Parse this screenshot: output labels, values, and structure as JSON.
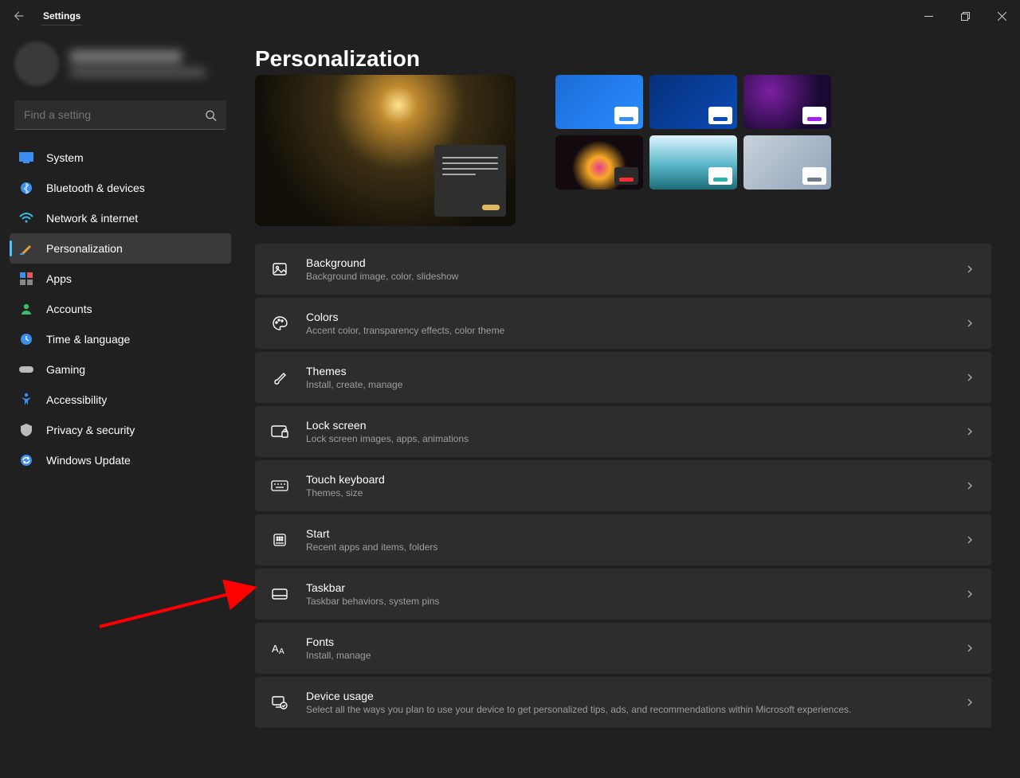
{
  "app_title": "Settings",
  "search": {
    "placeholder": "Find a setting"
  },
  "nav": [
    {
      "label": "System"
    },
    {
      "label": "Bluetooth & devices"
    },
    {
      "label": "Network & internet"
    },
    {
      "label": "Personalization"
    },
    {
      "label": "Apps"
    },
    {
      "label": "Accounts"
    },
    {
      "label": "Time & language"
    },
    {
      "label": "Gaming"
    },
    {
      "label": "Accessibility"
    },
    {
      "label": "Privacy & security"
    },
    {
      "label": "Windows Update"
    }
  ],
  "page_title": "Personalization",
  "theme_swatches": [
    "#3b90ef",
    "#0b4bb5",
    "#a020f0",
    "#ff2d2d",
    "#2bb3a7",
    "#6e7c8a"
  ],
  "rows": [
    {
      "title": "Background",
      "sub": "Background image, color, slideshow",
      "icon": "image"
    },
    {
      "title": "Colors",
      "sub": "Accent color, transparency effects, color theme",
      "icon": "palette"
    },
    {
      "title": "Themes",
      "sub": "Install, create, manage",
      "icon": "brush"
    },
    {
      "title": "Lock screen",
      "sub": "Lock screen images, apps, animations",
      "icon": "lock-screen"
    },
    {
      "title": "Touch keyboard",
      "sub": "Themes, size",
      "icon": "keyboard"
    },
    {
      "title": "Start",
      "sub": "Recent apps and items, folders",
      "icon": "start"
    },
    {
      "title": "Taskbar",
      "sub": "Taskbar behaviors, system pins",
      "icon": "taskbar"
    },
    {
      "title": "Fonts",
      "sub": "Install, manage",
      "icon": "fonts"
    },
    {
      "title": "Device usage",
      "sub": "Select all the ways you plan to use your device to get personalized tips, ads, and recommendations within Microsoft experiences.",
      "icon": "device-usage"
    }
  ]
}
